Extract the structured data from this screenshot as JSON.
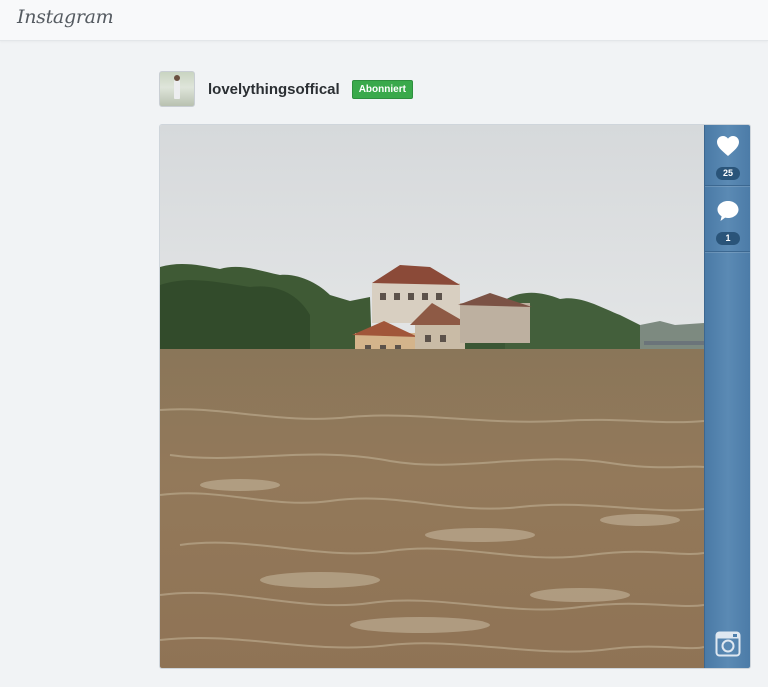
{
  "app": {
    "logo": "Instagram"
  },
  "post": {
    "username": "lovelythingsoffical",
    "follow_label": "Abonniert",
    "likes": "25",
    "comments": "1"
  },
  "icons": {
    "like": "heart-icon",
    "comment": "speech-bubble-icon",
    "camera": "instagram-camera-icon"
  },
  "colors": {
    "follow_button": "#3aa94b",
    "sidebar": "#5b8ab4"
  }
}
